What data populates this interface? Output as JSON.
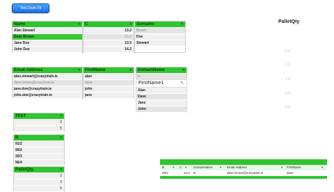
{
  "button": {
    "label": "Test Zoom Fit"
  },
  "name_slicer": {
    "header": "Name",
    "rows": [
      {
        "label": "Alan Stewart",
        "state": "normal"
      },
      {
        "label": "Dave Brown",
        "state": "selected"
      },
      {
        "label": "Jane Doe",
        "state": "normal"
      },
      {
        "label": "John Doe",
        "state": "normal"
      }
    ]
  },
  "c_slicer": {
    "header": "C",
    "rows": [
      {
        "label": "13.2",
        "state": "normal"
      },
      {
        "label": "13.2",
        "state": "normal"
      },
      {
        "label": "13.5",
        "state": "normal"
      },
      {
        "label": "14.2",
        "state": "normal"
      }
    ]
  },
  "surname_slicer": {
    "header": "Surname",
    "rows": [
      {
        "label": "Brown",
        "state": "dim"
      },
      {
        "label": "Doe",
        "state": "bold"
      },
      {
        "label": "Stewart",
        "state": "bold"
      }
    ]
  },
  "email_slicer": {
    "header": "Email Address",
    "rows": [
      {
        "label": "alan.stewart@crazytrain.ie",
        "state": "bold"
      },
      {
        "label": "dave.brown@crazytrain.ie",
        "state": "dim"
      },
      {
        "label": "jane.doe@crazytrain.ie",
        "state": "bold"
      },
      {
        "label": "john.doe@crazytrain.ie",
        "state": "bold"
      }
    ]
  },
  "firstname_slicer": {
    "header": "FirstName",
    "rows": [
      {
        "label": "alan",
        "state": "bold"
      },
      {
        "label": "dave",
        "state": "dim"
      },
      {
        "label": "john",
        "state": "bold"
      },
      {
        "label": "jane",
        "state": "bold"
      }
    ]
  },
  "domain_slicer": {
    "header": "DomainName",
    "rows": [
      {
        "label": "ie",
        "state": "dim"
      }
    ]
  },
  "firstname_filter": {
    "input_value": "FirstName1",
    "items": [
      "Alan",
      "Dave",
      "Jane",
      "John"
    ]
  },
  "test_slicer": {
    "header": "TEST",
    "rows": [
      {
        "label": "2",
        "state": "right"
      },
      {
        "label": "5",
        "state": "right"
      }
    ]
  },
  "b_slicer": {
    "header": "B",
    "rows": [
      {
        "label": "91/2",
        "state": "bold"
      },
      {
        "label": "95/2",
        "state": "bold"
      },
      {
        "label": "30/3",
        "state": "bold"
      },
      {
        "label": "96/4",
        "state": "bold"
      }
    ]
  },
  "palletqty_slicer": {
    "header": "PalletQty",
    "rows": [
      {
        "label": "2",
        "state": "right"
      },
      {
        "label": "3",
        "state": "right"
      },
      {
        "label": "5",
        "state": "right"
      }
    ]
  },
  "pallet_chart": {
    "title": "PalletQty",
    "ticks": [
      "2.0",
      "1.5",
      "1.0",
      "0.5",
      "0.0"
    ]
  },
  "table": {
    "columns": [
      "B",
      "C",
      "DomainName",
      "Email Address",
      "FirstName"
    ],
    "values": [
      "95/2",
      "13.2",
      "ie",
      "dave.brown@crazytrain.ie",
      "dave"
    ]
  },
  "colors": {
    "slicer_header": "#2ec52e",
    "selected": "#35c935",
    "button": "#1f6fd8"
  }
}
